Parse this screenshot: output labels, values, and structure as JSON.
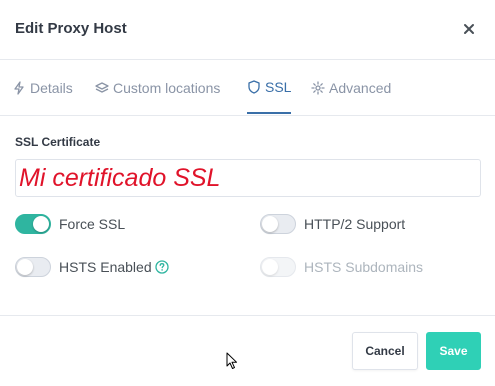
{
  "modal": {
    "title": "Edit Proxy Host"
  },
  "tabs": [
    {
      "label": "Details",
      "icon": "bolt-icon",
      "active": false
    },
    {
      "label": "Custom locations",
      "icon": "layers-icon",
      "active": false
    },
    {
      "label": "SSL",
      "icon": "shield-icon",
      "active": true
    },
    {
      "label": "Advanced",
      "icon": "gear-icon",
      "active": false
    }
  ],
  "ssl": {
    "certificate_label": "SSL Certificate",
    "certificate_value": "Mi certificado SSL",
    "toggles": {
      "force_ssl": {
        "label": "Force SSL",
        "checked": true,
        "disabled": false
      },
      "http2": {
        "label": "HTTP/2 Support",
        "checked": false,
        "disabled": false
      },
      "hsts": {
        "label": "HSTS Enabled",
        "checked": false,
        "disabled": false
      },
      "hsts_subdomains": {
        "label": "HSTS Subdomains",
        "checked": false,
        "disabled": true
      }
    }
  },
  "footer": {
    "cancel_label": "Cancel",
    "save_label": "Save"
  },
  "colors": {
    "accent": "#2fd0b6",
    "toggle_on": "#2fb5a0",
    "active_tab": "#3a6fa8",
    "certificate_text": "#e0132a"
  }
}
